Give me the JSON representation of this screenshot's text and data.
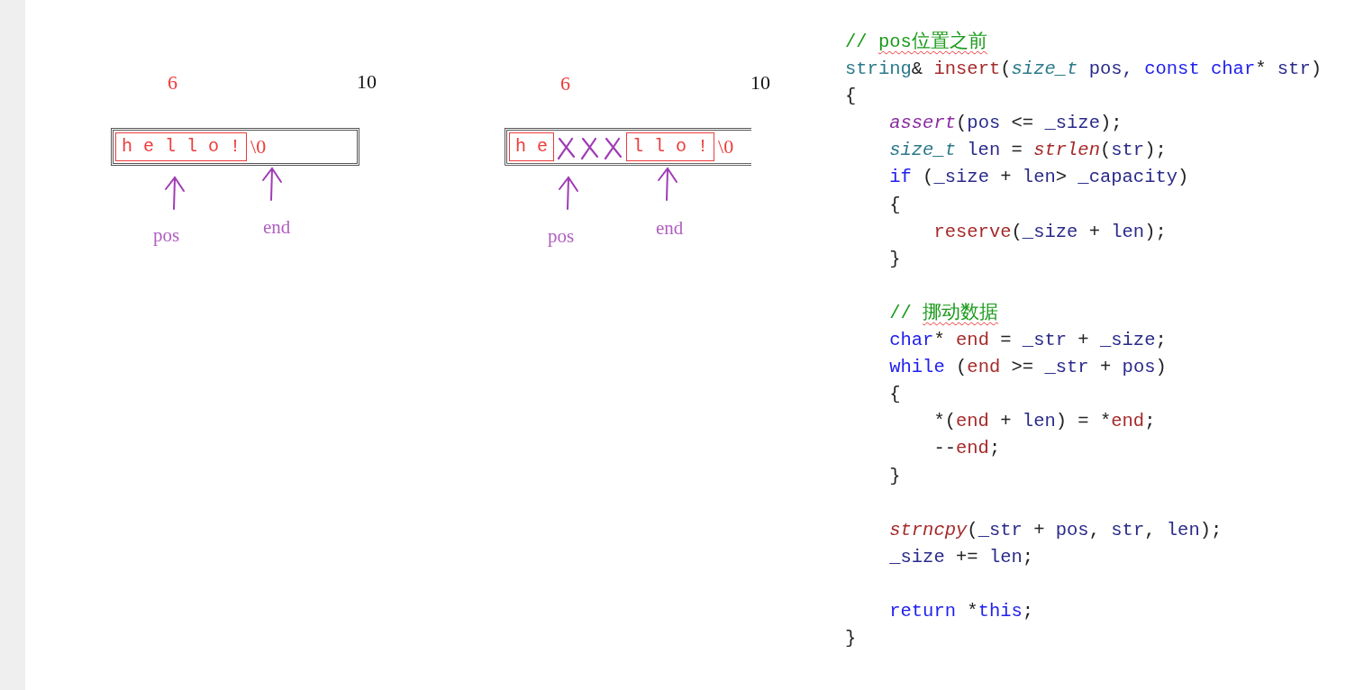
{
  "diagrams": [
    {
      "top_labels": [
        {
          "text": "6",
          "color": "#ee3b3b"
        },
        {
          "text": "10",
          "color": "#111111"
        }
      ],
      "cells": [
        {
          "kind": "chars",
          "text": "h e l l o !"
        },
        {
          "kind": "terminator",
          "text": "\\0"
        }
      ],
      "pointers": [
        {
          "label": "pos"
        },
        {
          "label": "end"
        }
      ]
    },
    {
      "top_labels": [
        {
          "text": "6",
          "color": "#ee3b3b"
        },
        {
          "text": "10",
          "color": "#111111"
        }
      ],
      "cells": [
        {
          "kind": "chars",
          "text": "h e"
        },
        {
          "kind": "cross"
        },
        {
          "kind": "cross"
        },
        {
          "kind": "cross"
        },
        {
          "kind": "chars",
          "text": "l l o !"
        },
        {
          "kind": "terminator",
          "text": "\\0"
        }
      ],
      "pointers": [
        {
          "label": "pos"
        },
        {
          "label": "end"
        }
      ]
    }
  ],
  "code_lines": [
    {
      "kind": "code",
      "tokens": [
        {
          "kind": "comment",
          "text": "// "
        },
        {
          "kind": "comment",
          "text": "pos位置之前",
          "spellcheck": true
        }
      ]
    },
    {
      "kind": "code",
      "tokens": [
        {
          "kind": "type",
          "text": "string"
        },
        {
          "kind": "plain",
          "text": "& "
        },
        {
          "kind": "func",
          "text": "insert"
        },
        {
          "kind": "plain",
          "text": "("
        },
        {
          "kind": "italic_type",
          "text": "size_t"
        },
        {
          "kind": "var",
          "text": " pos, "
        },
        {
          "kind": "keyword",
          "text": "const char"
        },
        {
          "kind": "plain",
          "text": "* "
        },
        {
          "kind": "var",
          "text": "str"
        },
        {
          "kind": "plain",
          "text": ")"
        }
      ]
    },
    {
      "kind": "code",
      "tokens": [
        {
          "kind": "plain",
          "text": "{"
        }
      ],
      "children": [
        {
          "kind": "code",
          "tokens": [
            {
              "kind": "macro",
              "text": "assert"
            },
            {
              "kind": "plain",
              "text": "("
            },
            {
              "kind": "var",
              "text": "pos"
            },
            {
              "kind": "plain",
              "text": " <= "
            },
            {
              "kind": "var",
              "text": "_size"
            },
            {
              "kind": "plain",
              "text": ");"
            }
          ]
        },
        {
          "kind": "code",
          "tokens": [
            {
              "kind": "italic_type",
              "text": "size_t"
            },
            {
              "kind": "var",
              "text": " len"
            },
            {
              "kind": "plain",
              "text": " = "
            },
            {
              "kind": "italic_func",
              "text": "strlen"
            },
            {
              "kind": "plain",
              "text": "("
            },
            {
              "kind": "var",
              "text": "str"
            },
            {
              "kind": "plain",
              "text": ");"
            }
          ]
        },
        {
          "kind": "code",
          "tokens": [
            {
              "kind": "keyword",
              "text": "if"
            },
            {
              "kind": "plain",
              "text": " ("
            },
            {
              "kind": "var",
              "text": "_size"
            },
            {
              "kind": "plain",
              "text": " + "
            },
            {
              "kind": "var",
              "text": "len"
            },
            {
              "kind": "plain",
              "text": "> "
            },
            {
              "kind": "var",
              "text": "_capacity"
            },
            {
              "kind": "plain",
              "text": ")"
            }
          ]
        },
        {
          "kind": "code",
          "tokens": [
            {
              "kind": "plain",
              "text": "{"
            }
          ],
          "children": [
            {
              "kind": "code",
              "tokens": [
                {
                  "kind": "func",
                  "text": "reserve"
                },
                {
                  "kind": "plain",
                  "text": "("
                },
                {
                  "kind": "var",
                  "text": "_size"
                },
                {
                  "kind": "plain",
                  "text": " + "
                },
                {
                  "kind": "var",
                  "text": "len"
                },
                {
                  "kind": "plain",
                  "text": ");"
                }
              ]
            }
          ]
        },
        {
          "kind": "code",
          "tokens": [
            {
              "kind": "plain",
              "text": "}"
            }
          ]
        },
        {
          "kind": "blank"
        },
        {
          "kind": "code",
          "tokens": [
            {
              "kind": "comment",
              "text": "// "
            },
            {
              "kind": "comment",
              "text": "挪动数据",
              "spellcheck": true
            }
          ]
        },
        {
          "kind": "code",
          "tokens": [
            {
              "kind": "keyword",
              "text": "char"
            },
            {
              "kind": "plain",
              "text": "* "
            },
            {
              "kind": "local",
              "text": "end"
            },
            {
              "kind": "plain",
              "text": " = "
            },
            {
              "kind": "var",
              "text": "_str"
            },
            {
              "kind": "plain",
              "text": " + "
            },
            {
              "kind": "var",
              "text": "_size"
            },
            {
              "kind": "plain",
              "text": ";"
            }
          ]
        },
        {
          "kind": "code",
          "tokens": [
            {
              "kind": "keyword",
              "text": "while"
            },
            {
              "kind": "plain",
              "text": " ("
            },
            {
              "kind": "local",
              "text": "end"
            },
            {
              "kind": "plain",
              "text": " >= "
            },
            {
              "kind": "var",
              "text": "_str"
            },
            {
              "kind": "plain",
              "text": " + "
            },
            {
              "kind": "var",
              "text": "pos"
            },
            {
              "kind": "plain",
              "text": ")"
            }
          ]
        },
        {
          "kind": "code",
          "tokens": [
            {
              "kind": "plain",
              "text": "{"
            }
          ],
          "children": [
            {
              "kind": "code",
              "tokens": [
                {
                  "kind": "plain",
                  "text": "*("
                },
                {
                  "kind": "local",
                  "text": "end"
                },
                {
                  "kind": "plain",
                  "text": " + "
                },
                {
                  "kind": "var",
                  "text": "len"
                },
                {
                  "kind": "plain",
                  "text": ") = *"
                },
                {
                  "kind": "local",
                  "text": "end"
                },
                {
                  "kind": "plain",
                  "text": ";"
                }
              ]
            },
            {
              "kind": "code",
              "tokens": [
                {
                  "kind": "plain",
                  "text": "--"
                },
                {
                  "kind": "local",
                  "text": "end"
                },
                {
                  "kind": "plain",
                  "text": ";"
                }
              ]
            }
          ]
        },
        {
          "kind": "code",
          "tokens": [
            {
              "kind": "plain",
              "text": "}"
            }
          ]
        },
        {
          "kind": "blank"
        },
        {
          "kind": "code",
          "tokens": [
            {
              "kind": "italic_func",
              "text": "strncpy"
            },
            {
              "kind": "plain",
              "text": "("
            },
            {
              "kind": "var",
              "text": "_str"
            },
            {
              "kind": "plain",
              "text": " + "
            },
            {
              "kind": "var",
              "text": "pos"
            },
            {
              "kind": "plain",
              "text": ", "
            },
            {
              "kind": "var",
              "text": "str"
            },
            {
              "kind": "plain",
              "text": ", "
            },
            {
              "kind": "var",
              "text": "len"
            },
            {
              "kind": "plain",
              "text": ");"
            }
          ]
        },
        {
          "kind": "code",
          "tokens": [
            {
              "kind": "var",
              "text": "_size"
            },
            {
              "kind": "plain",
              "text": " += "
            },
            {
              "kind": "var",
              "text": "len"
            },
            {
              "kind": "plain",
              "text": ";"
            }
          ]
        },
        {
          "kind": "blank"
        },
        {
          "kind": "code",
          "tokens": [
            {
              "kind": "keyword",
              "text": "return"
            },
            {
              "kind": "plain",
              "text": " *"
            },
            {
              "kind": "keyword",
              "text": "this"
            },
            {
              "kind": "plain",
              "text": ";"
            }
          ]
        }
      ]
    },
    {
      "kind": "code",
      "tokens": [
        {
          "kind": "plain",
          "text": "}"
        }
      ]
    }
  ]
}
